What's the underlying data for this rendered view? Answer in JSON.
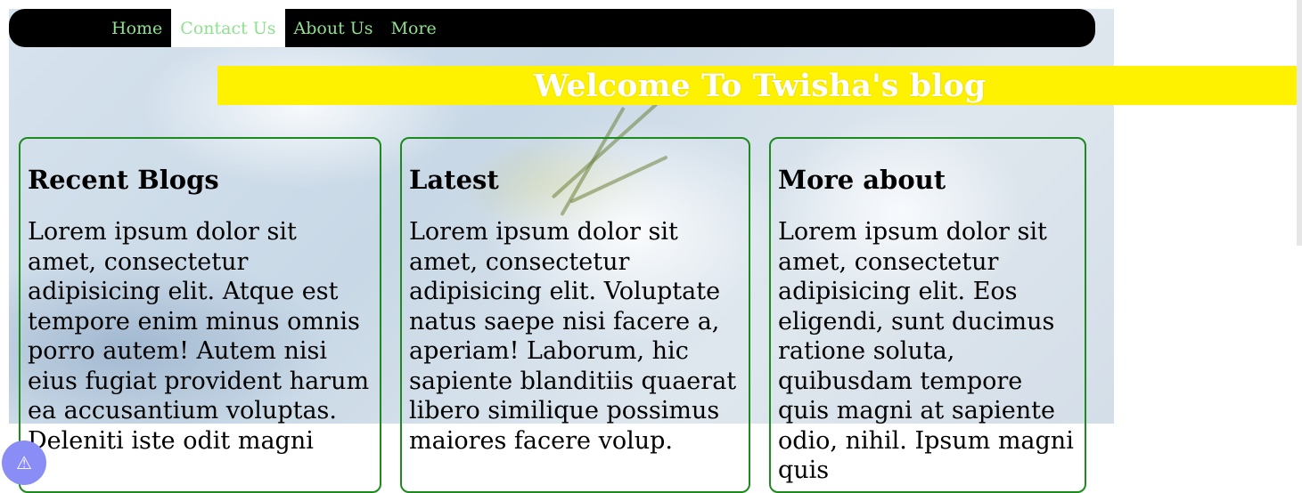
{
  "nav": {
    "items": [
      {
        "label": "Home"
      },
      {
        "label": "Contact Us",
        "active": true
      },
      {
        "label": "About Us"
      },
      {
        "label": "More"
      }
    ]
  },
  "banner": {
    "title": "Welcome To Twisha's blog"
  },
  "cards": [
    {
      "heading": "Recent Blogs",
      "text": "Lorem ipsum dolor sit amet, consectetur adipisicing elit. Atque est tempore enim minus omnis porro autem! Autem nisi eius fugiat provident harum ea accusantium voluptas. Deleniti iste odit magni"
    },
    {
      "heading": "Latest",
      "text": "Lorem ipsum dolor sit amet, consectetur adipisicing elit. Voluptate natus saepe nisi facere a, aperiam! Laborum, hic sapiente blanditiis quaerat libero similique possimus maiores facere volup."
    },
    {
      "heading": "More about",
      "text": "Lorem ipsum dolor sit amet, consectetur adipisicing elit. Eos eligendi, sunt ducimus ratione soluta, quibusdam tempore quis magni at sapiente odio, nihil. Ipsum magni quis"
    }
  ],
  "fab": {
    "icon": "warning-icon",
    "glyph": "⚠"
  },
  "colors": {
    "nav_bg": "#000000",
    "nav_text": "#8ee08e",
    "banner_bg": "#fff200",
    "card_border": "#1c8a1c"
  }
}
